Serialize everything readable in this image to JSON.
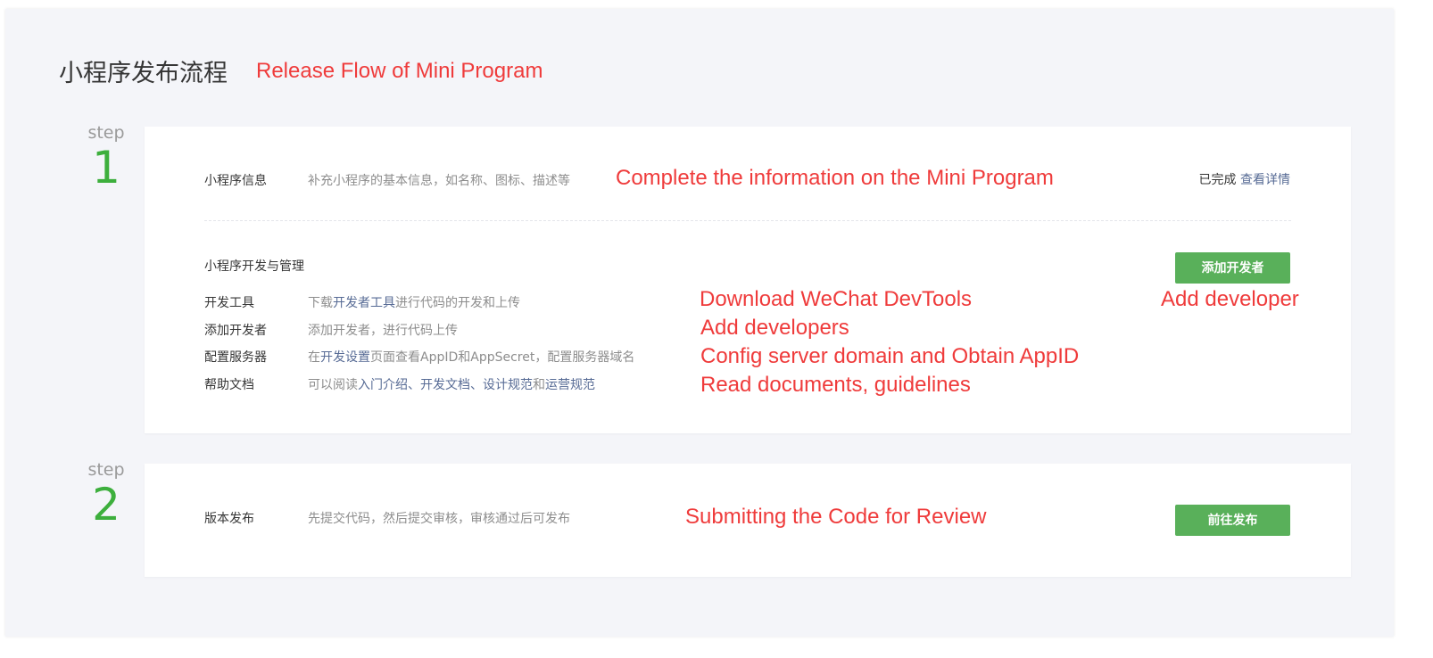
{
  "header": {
    "title": "小程序发布流程",
    "annotation": "Release Flow of Mini Program"
  },
  "step1": {
    "step_label": "step",
    "step_number": "1",
    "info": {
      "label": "小程序信息",
      "desc": "补充小程序的基本信息，如名称、图标、描述等",
      "annotation": "Complete the information on the Mini Program",
      "status": "已完成",
      "details_link": "查看详情"
    },
    "dev": {
      "section_title": "小程序开发与管理",
      "add_developer_button": "添加开发者",
      "button_annotation": "Add developer",
      "rows": [
        {
          "label": "开发工具",
          "desc_parts": [
            "下载",
            "开发者工具",
            "进行代码的开发和上传"
          ],
          "annotation": "Download WeChat DevTools"
        },
        {
          "label": "添加开发者",
          "desc_parts": [
            "添加开发者，进行代码上传"
          ],
          "annotation": "Add developers"
        },
        {
          "label": "配置服务器",
          "desc_parts": [
            "在",
            "开发设置",
            "页面查看AppID和AppSecret，配置服务器域名"
          ],
          "annotation": "Config server domain and Obtain AppID"
        },
        {
          "label": "帮助文档",
          "desc_parts": [
            "可以阅读",
            "入门介绍",
            "、",
            "开发文档",
            "、",
            "设计规范",
            "和",
            "运营规范"
          ],
          "annotation": "Read documents, guidelines"
        }
      ]
    }
  },
  "step2": {
    "step_label": "step",
    "step_number": "2",
    "label": "版本发布",
    "desc": "先提交代码，然后提交审核，审核通过后可发布",
    "annotation": "Submitting the Code for Review",
    "publish_button": "前往发布"
  },
  "colors": {
    "accent_green": "#59b05a",
    "step_green": "#3daf3d",
    "link_blue": "#576b95",
    "annotation_red": "#ef3b3b"
  }
}
